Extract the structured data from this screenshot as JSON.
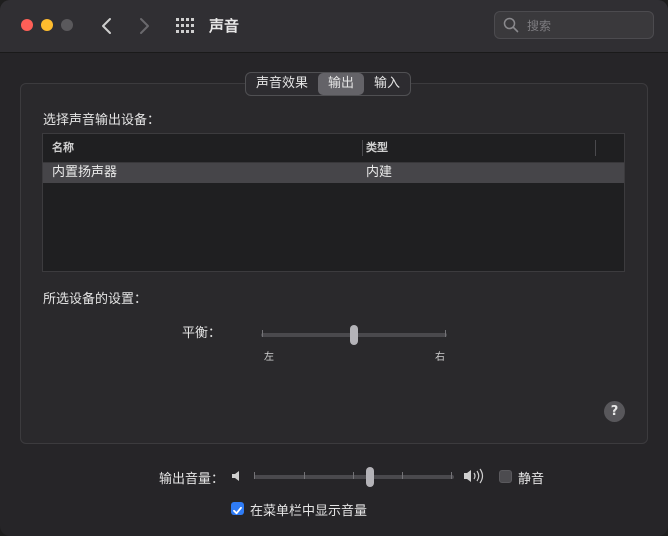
{
  "window": {
    "title": "声音",
    "search_placeholder": "搜索"
  },
  "tabs": [
    {
      "label": "声音效果",
      "selected": false
    },
    {
      "label": "输出",
      "selected": true
    },
    {
      "label": "输入",
      "selected": false
    }
  ],
  "output": {
    "select_device_label": "选择声音输出设备：",
    "columns": [
      "名称",
      "类型"
    ],
    "devices": [
      {
        "name": "内置扬声器",
        "type": "内建",
        "selected": true
      }
    ],
    "settings_label": "所选设备的设置：",
    "balance": {
      "label": "平衡：",
      "left_label": "左",
      "right_label": "右",
      "value": 0.5
    }
  },
  "help_label": "?",
  "footer": {
    "volume_label": "输出音量：",
    "volume_value": 0.59,
    "mute_label": "静音",
    "mute_checked": false,
    "menubar_label": "在菜单栏中显示音量",
    "menubar_checked": true
  },
  "colors": {
    "accent": "#2f7cf6",
    "close": "#fe5f57",
    "minimize": "#febc2e"
  }
}
